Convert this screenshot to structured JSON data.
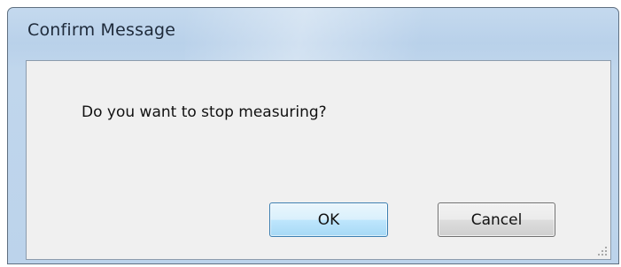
{
  "dialog": {
    "title": "Confirm Message",
    "message": "Do you want to stop measuring?",
    "buttons": {
      "ok_label": "OK",
      "cancel_label": "Cancel"
    },
    "default_button": "ok"
  },
  "colors": {
    "titlebar": "#bcd3eb",
    "client_background": "#f0f0f0",
    "default_button_border": "#3c7fb1"
  },
  "icons": {
    "resize_grip": "resize-grip-icon"
  }
}
